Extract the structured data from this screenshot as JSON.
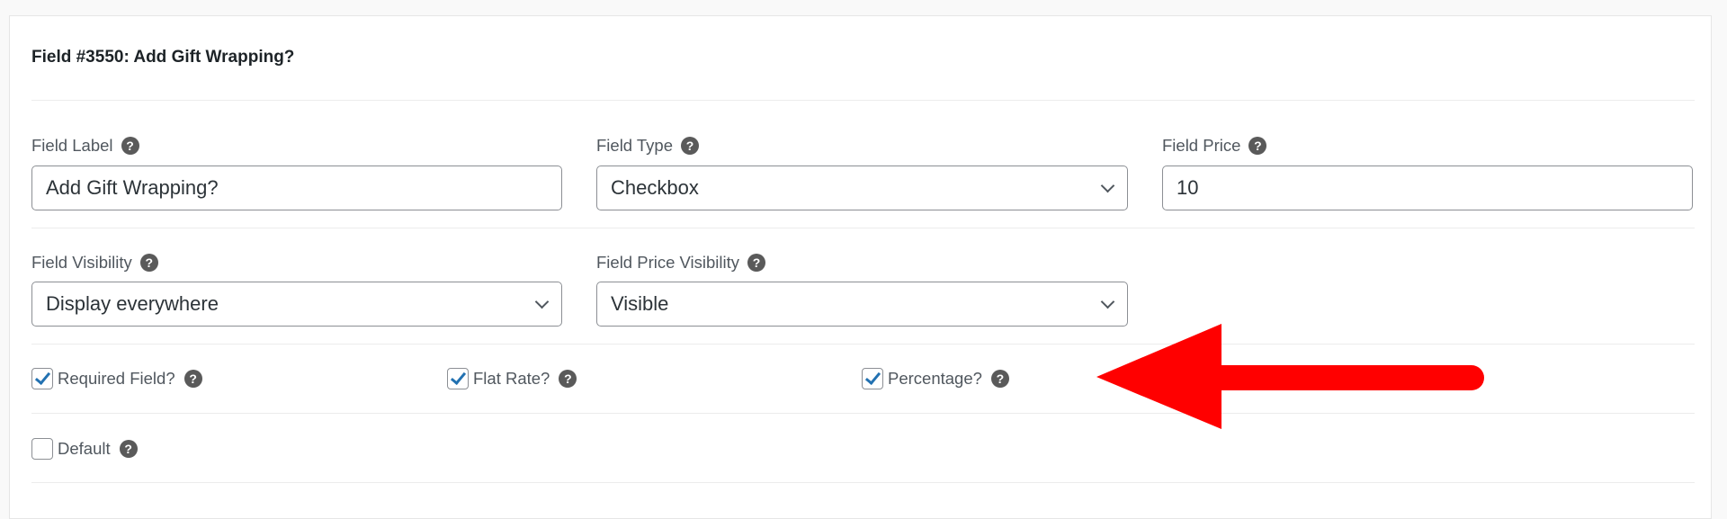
{
  "card": {
    "title": "Field #3550: Add Gift Wrapping?"
  },
  "fields": {
    "field_label": {
      "label": "Field Label",
      "value": "Add Gift Wrapping?"
    },
    "field_type": {
      "label": "Field Type",
      "value": "Checkbox"
    },
    "field_price": {
      "label": "Field Price",
      "value": "10"
    },
    "field_visibility": {
      "label": "Field Visibility",
      "value": "Display everywhere"
    },
    "field_price_visibility": {
      "label": "Field Price Visibility",
      "value": "Visible"
    }
  },
  "checkboxes": [
    {
      "label": "Required Field?",
      "checked": true
    },
    {
      "label": "Flat Rate?",
      "checked": true
    },
    {
      "label": "Percentage?",
      "checked": true
    },
    {
      "label": "Default",
      "checked": false
    }
  ],
  "icons": {
    "help": "?"
  },
  "annotation": {
    "arrow_color": "#ff0000",
    "arrow_direction": "left",
    "points_to": "Percentage?"
  }
}
